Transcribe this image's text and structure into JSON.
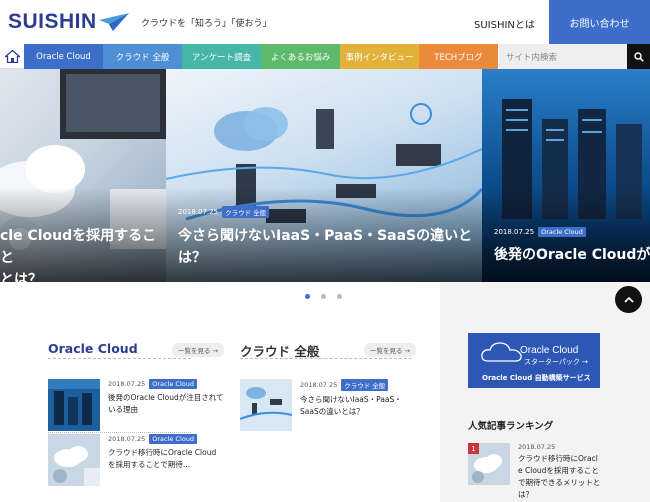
{
  "header": {
    "logo": "SUISHIN",
    "tagline": "クラウドを「知ろう」「使おう」",
    "about": "SUISHINとは",
    "contact": "お問い合わせ"
  },
  "nav": {
    "categories": [
      {
        "label": "Oracle Cloud",
        "color": "#3d6ec9"
      },
      {
        "label": "クラウド 全般",
        "color": "#4f8fd6"
      },
      {
        "label": "アンケート調査",
        "color": "#46b6a6"
      },
      {
        "label": "よくあるお悩み",
        "color": "#5cba6a"
      },
      {
        "label": "事例インタビュー",
        "color": "#e0b23a"
      },
      {
        "label": "TECHブログ",
        "color": "#ec8a3c"
      }
    ],
    "search_placeholder": "サイト内検索"
  },
  "slides": [
    {
      "date": "",
      "badge": "",
      "title_line1": "cle Cloudを採用すること",
      "title_line2": "とは？"
    },
    {
      "date": "2018.07.25",
      "badge": "クラウド 全般",
      "title_line1": "今さら聞けないIaaS・PaaS・SaaSの違いと",
      "title_line2": "は？"
    },
    {
      "date": "2018.07.25",
      "badge": "Oracle Cloud",
      "title_line1": "後発のOracle Cloudが注目",
      "title_line2": ""
    }
  ],
  "sections": {
    "oracle": {
      "title": "Oracle Cloud",
      "more": "一覧を見る →",
      "items": [
        {
          "date": "2018.07.25",
          "badge": "Oracle Cloud",
          "title_line1": "後発のOracle Cloudが注目されて",
          "title_line2": "いる理由"
        },
        {
          "date": "2018.07.25",
          "badge": "Oracle Cloud",
          "title_line1": "クラウド移行時にOracle Cloud",
          "title_line2": "を採用することで期待…"
        }
      ]
    },
    "cloud": {
      "title": "クラウド 全般",
      "more": "一覧を見る →",
      "items": [
        {
          "date": "2018.07.25",
          "badge": "クラウド 全般",
          "title_line1": "今さら聞けないIaaS・PaaS・",
          "title_line2": "SaaSの違いとは？"
        }
      ]
    }
  },
  "sidebar": {
    "banner_title": "Oracle Cloud",
    "banner_sub": "スターターパック →",
    "banner_caption": "Oracle Cloud 自動構築サービス",
    "ranking_title": "人気記事ランキング",
    "ranking": [
      {
        "rank": "1",
        "date": "2018.07.25",
        "title_line1": "クラウド移行時にOracl",
        "title_line2": "e Cloudを採用すること",
        "title_line3": "で期待できるメリットと",
        "title_line4": "は？"
      }
    ]
  }
}
